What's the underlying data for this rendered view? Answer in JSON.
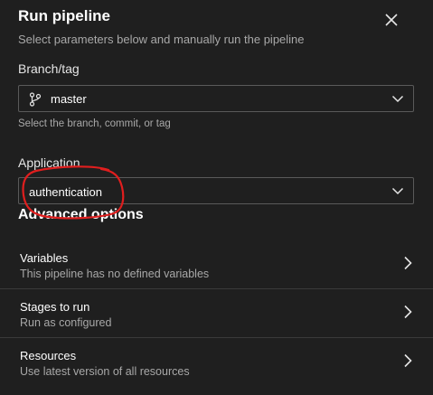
{
  "dialog": {
    "title": "Run pipeline",
    "subtitle": "Select parameters below and manually run the pipeline"
  },
  "branch": {
    "label": "Branch/tag",
    "value": "master",
    "icon": "branch-icon",
    "hint": "Select the branch, commit, or tag"
  },
  "application": {
    "label": "Application",
    "value": "authentication"
  },
  "advanced": {
    "title": "Advanced options",
    "rows": [
      {
        "title": "Variables",
        "description": "This pipeline has no defined variables"
      },
      {
        "title": "Stages to run",
        "description": "Run as configured"
      },
      {
        "title": "Resources",
        "description": "Use latest version of all resources"
      }
    ]
  },
  "colors": {
    "background": "#1f1f1f",
    "annotation": "#e01e1e",
    "border": "#5a5a5a"
  }
}
